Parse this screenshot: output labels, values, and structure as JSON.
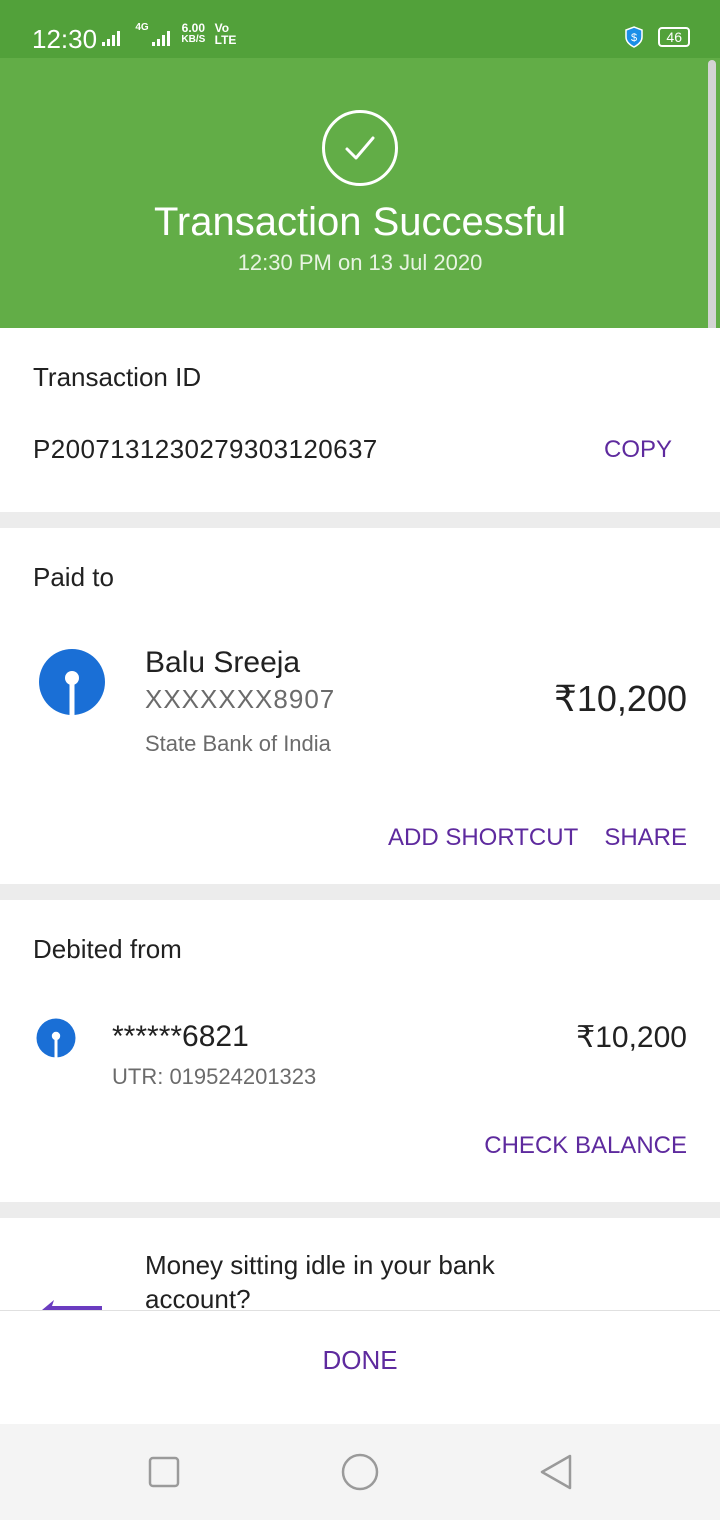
{
  "status_bar": {
    "time": "12:30",
    "network": "4G",
    "speed_value": "6.00",
    "speed_unit": "KB/S",
    "volte": "Vo LTE",
    "battery": "46"
  },
  "header": {
    "title": "Transaction Successful",
    "subtitle": "12:30 PM on 13 Jul 2020",
    "icon": "check-circle-icon",
    "bg_color": "#62ad47"
  },
  "transaction": {
    "label": "Transaction ID",
    "id": "P2007131230279303120637",
    "copy_label": "COPY"
  },
  "paid_to": {
    "label": "Paid to",
    "name": "Balu Sreeja",
    "account": "XXXXXXX8907",
    "bank": "State Bank of India",
    "amount": "₹10,200",
    "add_shortcut_label": "ADD SHORTCUT",
    "share_label": "SHARE"
  },
  "debited_from": {
    "label": "Debited from",
    "account": "******6821",
    "utr": "UTR: 019524201323",
    "amount": "₹10,200",
    "check_balance_label": "CHECK BALANCE"
  },
  "promo": {
    "text": "Money sitting idle in your bank account?"
  },
  "footer": {
    "done_label": "DONE"
  },
  "colors": {
    "accent": "#5e2a9e",
    "success_green": "#62ad47",
    "sbi_blue": "#1a6fd6"
  }
}
